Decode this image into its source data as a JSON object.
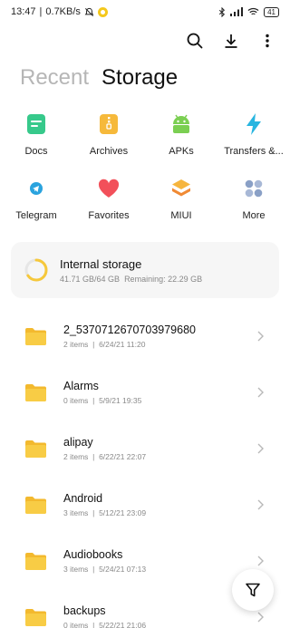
{
  "status_bar": {
    "time": "13:47",
    "speed": "0.7KB/s",
    "battery": "41",
    "icons": [
      "mute-icon",
      "app-notification-icon",
      "bluetooth-icon",
      "signal-icon",
      "wifi-icon",
      "battery-icon"
    ]
  },
  "toolbar": {
    "icons": [
      "search-icon",
      "download-icon",
      "more-vertical-icon"
    ]
  },
  "tabs": [
    {
      "label": "Recent",
      "active": false
    },
    {
      "label": "Storage",
      "active": true
    }
  ],
  "categories": [
    {
      "label": "Docs",
      "icon": "docs-icon",
      "color": "#37c98b"
    },
    {
      "label": "Archives",
      "icon": "archive-icon",
      "color": "#f6b93b"
    },
    {
      "label": "APKs",
      "icon": "android-icon",
      "color": "#7bcf52"
    },
    {
      "label": "Transfers &...",
      "icon": "transfer-icon",
      "color": "#28b5e0"
    },
    {
      "label": "Telegram",
      "icon": "telegram-icon",
      "color": "#2aa3de"
    },
    {
      "label": "Favorites",
      "icon": "heart-icon",
      "color": "#f2505a"
    },
    {
      "label": "MIUI",
      "icon": "miui-icon",
      "color": "#f39a3c"
    },
    {
      "label": "More",
      "icon": "more-grid-icon",
      "color": "#8aa0c6"
    }
  ],
  "storage": {
    "title": "Internal storage",
    "used": "41.71 GB/64 GB",
    "remaining": "Remaining: 22.29 GB",
    "used_fraction": 0.652,
    "ring_color": "#f6c83b"
  },
  "folders": [
    {
      "name": "2_5370712670703979680",
      "items": "2 items",
      "date": "6/24/21 11:20"
    },
    {
      "name": "Alarms",
      "items": "0 items",
      "date": "5/9/21 19:35"
    },
    {
      "name": "alipay",
      "items": "2 items",
      "date": "6/22/21 22:07"
    },
    {
      "name": "Android",
      "items": "3 items",
      "date": "5/12/21 23:09"
    },
    {
      "name": "Audiobooks",
      "items": "3 items",
      "date": "5/24/21 07:13"
    },
    {
      "name": "backups",
      "items": "0 items",
      "date": "5/22/21 21:06"
    }
  ],
  "colors": {
    "folder": "#f8cc45",
    "folder_tab": "#f3b92e",
    "accent_text": "#111111"
  },
  "fab_icon": "filter-icon"
}
